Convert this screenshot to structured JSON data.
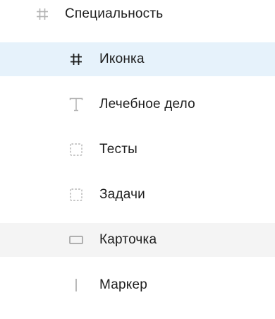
{
  "layers": [
    {
      "label": "Специальность",
      "icon": "frame-grid-icon",
      "state": "normal",
      "level": "parent"
    },
    {
      "label": "Иконка",
      "icon": "frame-grid-icon",
      "state": "selected",
      "level": "child"
    },
    {
      "label": "Лечебное дело",
      "icon": "text-icon",
      "state": "normal",
      "level": "child"
    },
    {
      "label": "Тесты",
      "icon": "dashed-frame-icon",
      "state": "normal",
      "level": "child"
    },
    {
      "label": "Задачи",
      "icon": "dashed-frame-icon",
      "state": "normal",
      "level": "child"
    },
    {
      "label": "Карточка",
      "icon": "rectangle-icon",
      "state": "hover",
      "level": "child"
    },
    {
      "label": "Маркер",
      "icon": "line-icon",
      "state": "normal",
      "level": "child"
    }
  ],
  "colors": {
    "selected_bg": "#e6f2fb",
    "hover_bg": "#f4f4f4",
    "text": "#1e1e1e",
    "icon_muted": "#b3b3b3",
    "icon_dark": "#1e1e1e"
  }
}
